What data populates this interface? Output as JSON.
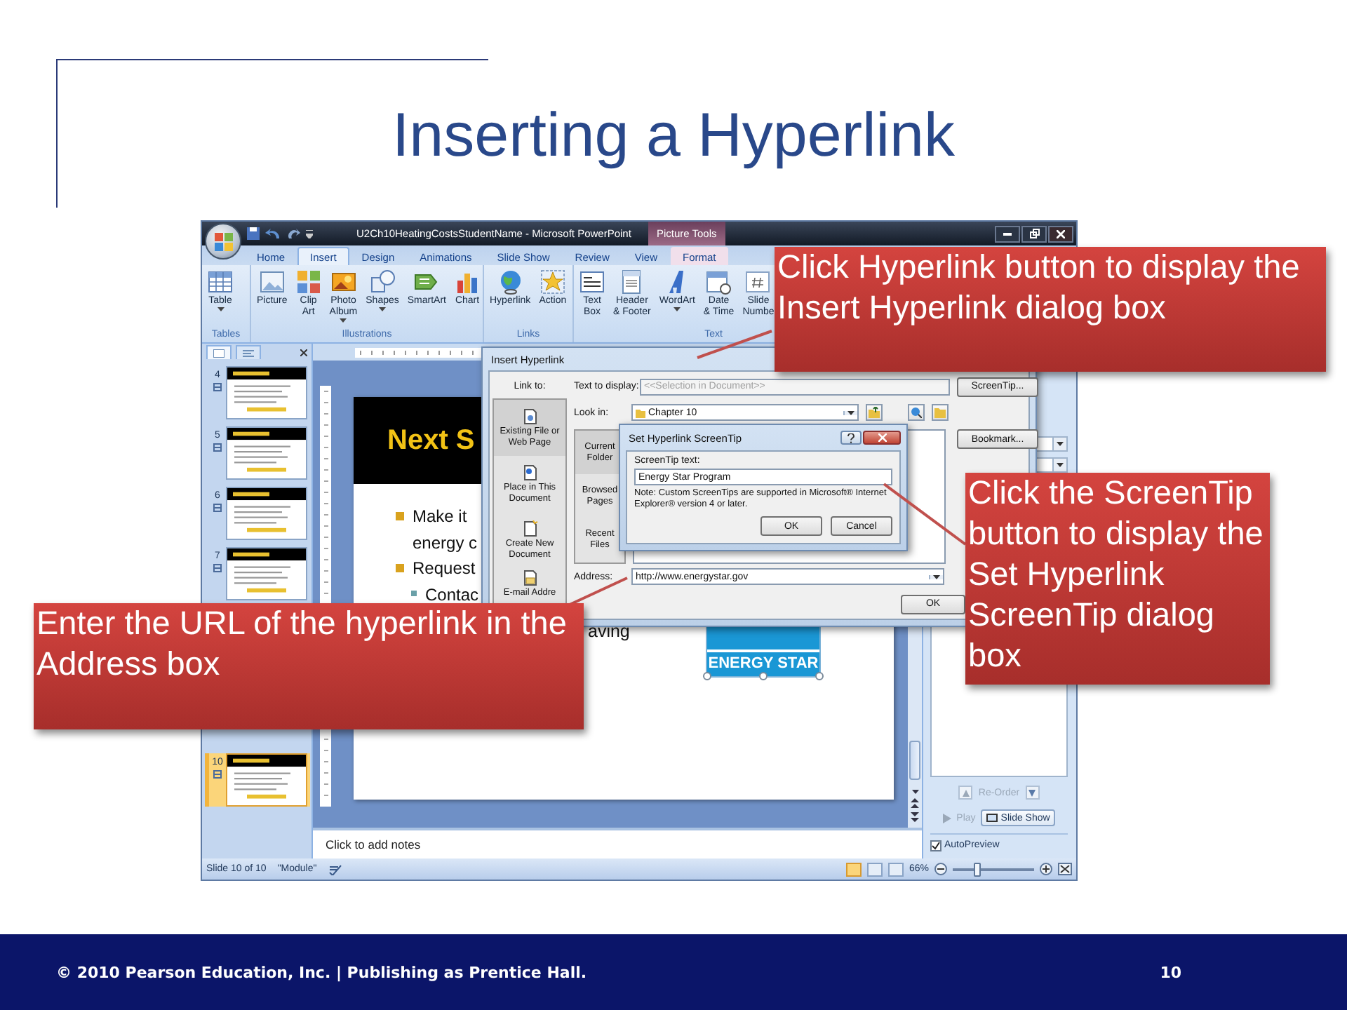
{
  "slide": {
    "title": "Inserting a Hyperlink",
    "footer_text": "© 2010 Pearson Education, Inc. | Publishing as Prentice Hall.",
    "page_number": "10"
  },
  "powerpoint": {
    "title": "U2Ch10HeatingCostsStudentName - Microsoft PowerPoint",
    "context_tab_group": "Picture Tools",
    "tabs": [
      {
        "label": "Home",
        "selected": false,
        "kind": "standard"
      },
      {
        "label": "Insert",
        "selected": true,
        "kind": "standard"
      },
      {
        "label": "Design",
        "selected": false,
        "kind": "standard"
      },
      {
        "label": "Animations",
        "selected": false,
        "kind": "standard"
      },
      {
        "label": "Slide Show",
        "selected": false,
        "kind": "standard"
      },
      {
        "label": "Review",
        "selected": false,
        "kind": "standard"
      },
      {
        "label": "View",
        "selected": false,
        "kind": "standard"
      },
      {
        "label": "Format",
        "selected": false,
        "kind": "contextual"
      }
    ],
    "ribbon_groups": [
      {
        "label": "Tables",
        "buttons": [
          {
            "label": "Table",
            "has_menu": true
          }
        ]
      },
      {
        "label": "Illustrations",
        "buttons": [
          {
            "label": "Picture",
            "has_menu": false
          },
          {
            "label": "Clip\nArt",
            "has_menu": false
          },
          {
            "label": "Photo\nAlbum",
            "has_menu": true
          },
          {
            "label": "Shapes",
            "has_menu": true
          },
          {
            "label": "SmartArt",
            "has_menu": false
          },
          {
            "label": "Chart",
            "has_menu": false
          }
        ]
      },
      {
        "label": "Links",
        "buttons": [
          {
            "label": "Hyperlink",
            "has_menu": false
          },
          {
            "label": "Action",
            "has_menu": false
          }
        ]
      },
      {
        "label": "Text",
        "buttons": [
          {
            "label": "Text\nBox",
            "has_menu": false
          },
          {
            "label": "Header\n& Footer",
            "has_menu": false
          },
          {
            "label": "WordArt",
            "has_menu": true
          },
          {
            "label": "Date\n& Time",
            "has_menu": false
          },
          {
            "label": "Slide\nNumbe",
            "has_menu": false
          }
        ]
      }
    ],
    "thumbnails": [
      {
        "number": "4",
        "selected": false
      },
      {
        "number": "5",
        "selected": false
      },
      {
        "number": "6",
        "selected": false
      },
      {
        "number": "7",
        "selected": false
      },
      {
        "number": "10",
        "selected": true
      }
    ],
    "slide_canvas": {
      "heading": "Next S",
      "bullets": [
        {
          "lines": [
            "Make it",
            "energy c"
          ]
        },
        {
          "lines": [
            "Request"
          ],
          "children": [
            {
              "lines": [
                "Contac"
              ]
            }
          ]
        }
      ],
      "trailing_fragment": "aving",
      "logo_text": "ENERGY STAR"
    },
    "notes_placeholder": "Click to add notes",
    "task_pane": {
      "reorder_label": "Re-Order",
      "play_label": "Play",
      "slide_show_label": "Slide Show",
      "autopreview": {
        "label": "AutoPreview",
        "checked": true
      }
    },
    "status_bar": {
      "slide_info": "Slide 10 of 10",
      "theme": "\"Module\"",
      "zoom": "66%",
      "zoom_slider": {
        "level": 0.3
      }
    }
  },
  "insert_hyperlink_dialog": {
    "title": "Insert Hyperlink",
    "link_to_label": "Link to:",
    "link_targets": [
      {
        "label": "Existing File or\nWeb Page",
        "selected": true
      },
      {
        "label": "Place in This\nDocument",
        "selected": false
      },
      {
        "label": "Create New\nDocument",
        "selected": false
      },
      {
        "label": "E-mail Addre",
        "selected": false
      }
    ],
    "text_to_display": {
      "label": "Text to display:",
      "value": "<<Selection in Document>>",
      "disabled": true
    },
    "screentip_button": "ScreenTip...",
    "look_in": {
      "label": "Look in:",
      "value": "Chapter 10"
    },
    "browse_options": [
      {
        "label": "Current\nFolder",
        "selected": true
      },
      {
        "label": "Browsed\nPages",
        "selected": false
      },
      {
        "label": "Recent\nFiles",
        "selected": false
      }
    ],
    "bookmark_button": "Bookmark...",
    "address": {
      "label": "Address:",
      "value": "http://www.energystar.gov"
    },
    "ok_button": "OK"
  },
  "screentip_dialog": {
    "title": "Set Hyperlink ScreenTip",
    "field_label": "ScreenTip text:",
    "value": "Energy Star Program",
    "note": "Note: Custom ScreenTips are supported in Microsoft® Internet Explorer® version 4 or later.",
    "buttons": [
      "OK",
      "Cancel"
    ]
  },
  "callouts": [
    {
      "text": "Click Hyperlink button to display the Insert Hyperlink dialog box"
    },
    {
      "text": "Enter the URL of the hyperlink in the Address box"
    },
    {
      "text": "Click the ScreenTip button to display the Set Hyperlink ScreenTip dialog box"
    }
  ]
}
